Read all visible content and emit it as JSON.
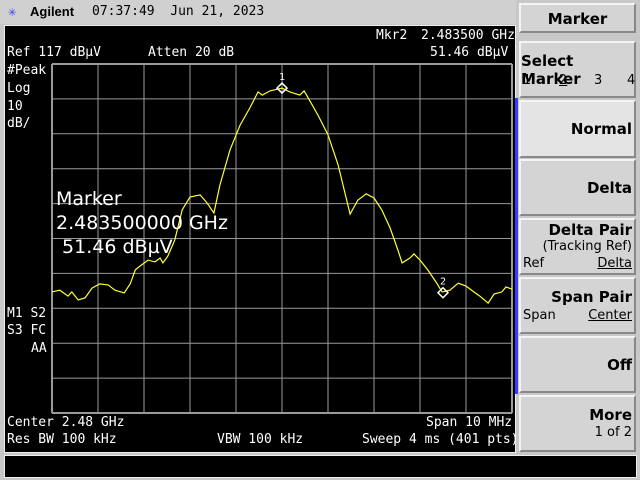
{
  "header": {
    "brand": "Agilent",
    "time": "07:37:49",
    "date": "Jun 21, 2023",
    "logo_icon": "agilent-spark-icon"
  },
  "display": {
    "marker_readout_label": "Mkr2",
    "marker_readout_freq": "2.483500 GHz",
    "marker_readout_level": "51.46 dBµV",
    "ref_level": "Ref 117 dBµV",
    "atten": "Atten 20 dB",
    "detector": "#Peak",
    "scale_type": "Log",
    "scale_value": "10",
    "scale_unit": "dB/",
    "flags": [
      "M1 S2",
      "S3 FC",
      "AA"
    ],
    "marker_box": {
      "title": "Marker",
      "freq": "2.483500000 GHz",
      "level": " 51.46 dBµV"
    },
    "center": "Center 2.48 GHz",
    "span": "Span 10 MHz",
    "res_bw": "Res BW 100 kHz",
    "vbw": "VBW 100 kHz",
    "sweep": "Sweep 4 ms (401 pts)"
  },
  "trace": {
    "color": "#ffff33",
    "ref_dbuv": 117,
    "db_per_div": 10,
    "divisions": 10,
    "center_ghz": 2.48,
    "span_mhz": 10,
    "points_offset_mhz_dbuv": [
      [
        -5.0,
        51.7
      ],
      [
        -4.83,
        52.2
      ],
      [
        -4.65,
        50.5
      ],
      [
        -4.57,
        51.7
      ],
      [
        -4.43,
        49.4
      ],
      [
        -4.28,
        50.0
      ],
      [
        -4.13,
        52.8
      ],
      [
        -3.96,
        54.0
      ],
      [
        -3.78,
        53.7
      ],
      [
        -3.63,
        52.2
      ],
      [
        -3.43,
        51.4
      ],
      [
        -3.3,
        54.0
      ],
      [
        -3.19,
        58.0
      ],
      [
        -3.09,
        59.1
      ],
      [
        -2.91,
        60.8
      ],
      [
        -2.76,
        60.3
      ],
      [
        -2.65,
        61.4
      ],
      [
        -2.59,
        60.0
      ],
      [
        -2.48,
        62.0
      ],
      [
        -2.33,
        66.6
      ],
      [
        -2.17,
        75.2
      ],
      [
        -2.0,
        78.9
      ],
      [
        -1.78,
        79.5
      ],
      [
        -1.63,
        77.2
      ],
      [
        -1.48,
        74.3
      ],
      [
        -1.35,
        82.3
      ],
      [
        -1.13,
        92.4
      ],
      [
        -0.91,
        99.5
      ],
      [
        -0.7,
        104.4
      ],
      [
        -0.52,
        109.0
      ],
      [
        -0.43,
        108.1
      ],
      [
        -0.26,
        109.3
      ],
      [
        0.0,
        110.1
      ],
      [
        0.17,
        109.0
      ],
      [
        0.39,
        108.1
      ],
      [
        0.48,
        109.3
      ],
      [
        0.57,
        107.3
      ],
      [
        0.78,
        102.4
      ],
      [
        1.0,
        96.7
      ],
      [
        1.22,
        88.1
      ],
      [
        1.48,
        74.0
      ],
      [
        1.65,
        78.0
      ],
      [
        1.83,
        79.8
      ],
      [
        2.0,
        78.6
      ],
      [
        2.17,
        75.2
      ],
      [
        2.35,
        70.0
      ],
      [
        2.52,
        63.7
      ],
      [
        2.61,
        60.0
      ],
      [
        2.78,
        61.4
      ],
      [
        2.87,
        62.6
      ],
      [
        3.0,
        60.8
      ],
      [
        3.17,
        58.0
      ],
      [
        3.35,
        54.5
      ],
      [
        3.48,
        51.7
      ],
      [
        3.65,
        52.2
      ],
      [
        3.83,
        54.2
      ],
      [
        4.0,
        53.4
      ],
      [
        4.17,
        51.7
      ],
      [
        4.3,
        50.5
      ],
      [
        4.48,
        48.5
      ],
      [
        4.61,
        51.1
      ],
      [
        4.78,
        51.7
      ],
      [
        4.87,
        53.1
      ],
      [
        5.0,
        52.5
      ]
    ],
    "markers": [
      {
        "label": "1",
        "offset_mhz": 0.0,
        "level_dbuv": 110.1
      },
      {
        "label": "2",
        "offset_mhz": 3.5,
        "level_dbuv": 51.46
      }
    ]
  },
  "softkeys": {
    "title": "Marker",
    "select_marker": {
      "label": "Select Marker",
      "options": [
        "1",
        "2",
        "3",
        "4"
      ],
      "selected": "2"
    },
    "normal": "Normal",
    "delta": "Delta",
    "delta_pair": {
      "label": "Delta Pair",
      "sub": "(Tracking Ref)",
      "left": "Ref",
      "right": "Delta"
    },
    "span_pair": {
      "label": "Span Pair",
      "left": "Span",
      "right": "Center"
    },
    "off": "Off",
    "more": {
      "label": "More",
      "sub": "1 of 2"
    }
  }
}
